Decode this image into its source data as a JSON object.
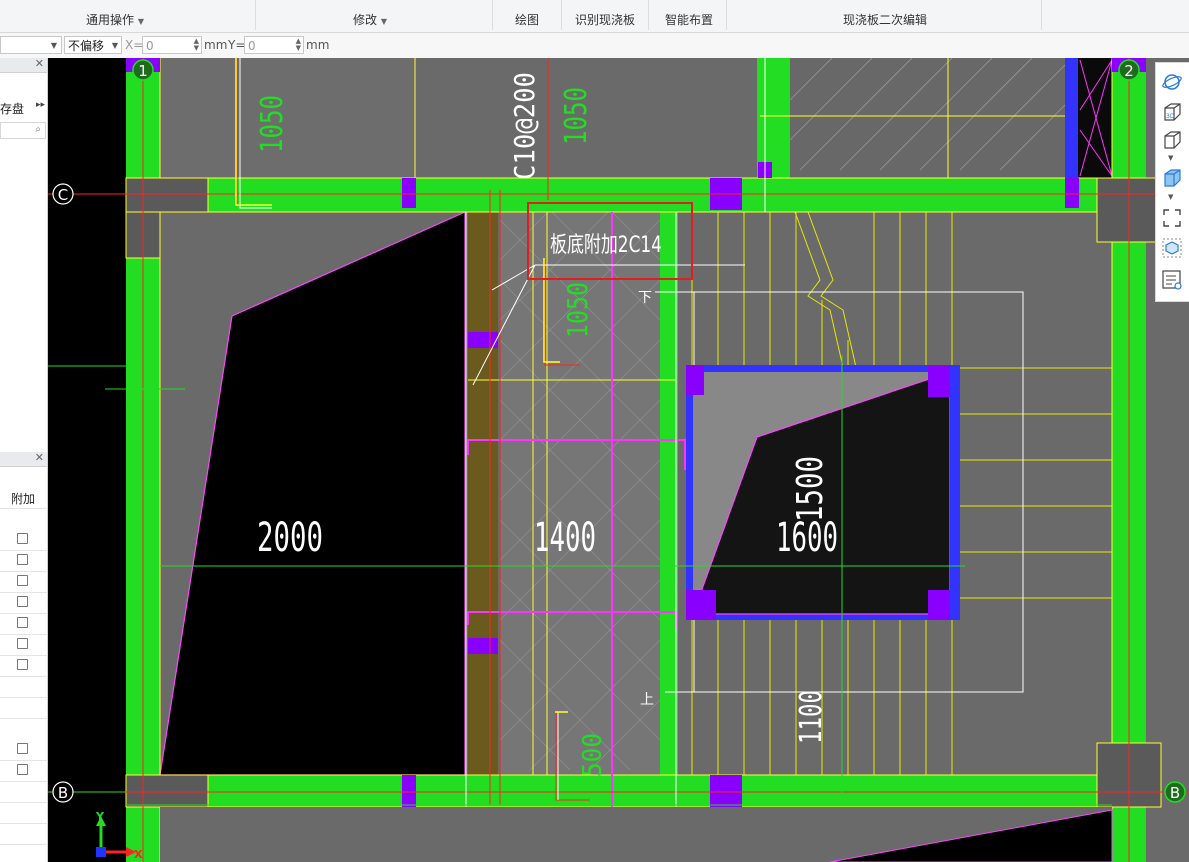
{
  "ribbon": {
    "groups": [
      {
        "label": "通用操作",
        "dropdown": true
      },
      {
        "label": "修改",
        "dropdown": true
      },
      {
        "label": "绘图",
        "dropdown": false
      },
      {
        "label": "识别现浇板",
        "dropdown": false
      },
      {
        "label": "智能布置",
        "dropdown": false
      },
      {
        "label": "现浇板二次编辑",
        "dropdown": false
      }
    ]
  },
  "toolbar": {
    "offset_mode": "不偏移",
    "x_label": "X=",
    "x_value": "0",
    "y_label": "Y=",
    "y_value": "0",
    "unit": "mm"
  },
  "left_panel": {
    "top_label": "存盘",
    "bottom_header": "附加"
  },
  "drawing": {
    "axis_labels": {
      "axis_1": "1",
      "axis_2": "2",
      "axis_c": "C",
      "axis_b": "B"
    },
    "dimensions": {
      "dim_2000": "2000",
      "dim_1400": "1400",
      "dim_1600": "1600",
      "dim_1500": "1500",
      "dim_1100": "1100",
      "dim_1050_top": "1050",
      "dim_1050_top2": "1050",
      "dim_1050_mid": "1050",
      "dim_500": "500"
    },
    "rebar_top": "C10@200",
    "rebar_annotation": "板底附加2C14",
    "stair_down": "下",
    "stair_up": "上",
    "ucs_y": "Y",
    "ucs_x": "X",
    "highlight_color": "#e02020",
    "beam_color": "#22dd22",
    "column_color": "#8a00ff"
  }
}
